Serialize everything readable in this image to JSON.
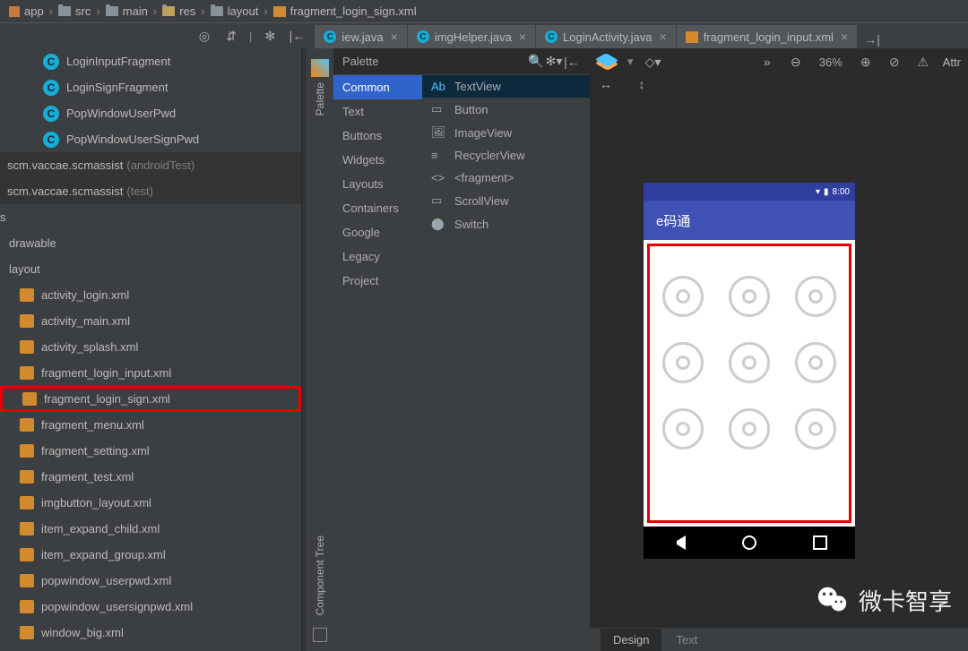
{
  "breadcrumb": [
    "app",
    "src",
    "main",
    "res",
    "layout",
    "fragment_login_sign.xml"
  ],
  "tabs": [
    {
      "label": "iew.java",
      "type": "c",
      "has_close": true
    },
    {
      "label": "imgHelper.java",
      "type": "c",
      "has_close": true
    },
    {
      "label": "LoginActivity.java",
      "type": "c",
      "has_close": true
    },
    {
      "label": "fragment_login_input.xml",
      "type": "xml",
      "has_close": true
    }
  ],
  "sidebar": {
    "classes": [
      "LoginInputFragment",
      "LoginSignFragment",
      "PopWindowUserPwd",
      "PopWindowUserSignPwd"
    ],
    "packages": [
      {
        "name": "scm.vaccae.scmassist",
        "suffix": "(androidTest)"
      },
      {
        "name": "scm.vaccae.scmassist",
        "suffix": "(test)"
      }
    ],
    "s_folder": "s",
    "drawable": "drawable",
    "layout_folder": "layout",
    "xml_files": [
      "activity_login.xml",
      "activity_main.xml",
      "activity_splash.xml",
      "fragment_login_input.xml",
      "fragment_login_sign.xml",
      "fragment_menu.xml",
      "fragment_setting.xml",
      "fragment_test.xml",
      "imgbutton_layout.xml",
      "item_expand_child.xml",
      "item_expand_group.xml",
      "popwindow_userpwd.xml",
      "popwindow_usersignpwd.xml",
      "window_big.xml"
    ],
    "highlighted": "fragment_login_sign.xml"
  },
  "palette": {
    "title": "Palette",
    "tree_label": "Component Tree",
    "categories": [
      "Common",
      "Text",
      "Buttons",
      "Widgets",
      "Layouts",
      "Containers",
      "Google",
      "Legacy",
      "Project"
    ],
    "selected_category": "Common",
    "items": [
      {
        "icon": "Ab",
        "label": "TextView",
        "sel": true
      },
      {
        "icon": "▭",
        "label": "Button"
      },
      {
        "icon": "🖼",
        "label": "ImageView"
      },
      {
        "icon": "≡",
        "label": "RecyclerView"
      },
      {
        "icon": "<>",
        "label": "<fragment>"
      },
      {
        "icon": "▭",
        "label": "ScrollView"
      },
      {
        "icon": "⬤",
        "label": "Switch"
      }
    ]
  },
  "preview": {
    "zoom": "36%",
    "app_title": "e码通",
    "status_time": "8:00"
  },
  "bottom_tabs": {
    "design": "Design",
    "text": "Text"
  },
  "toolbar_right_label": "Attr",
  "watermark": "微卡智享"
}
